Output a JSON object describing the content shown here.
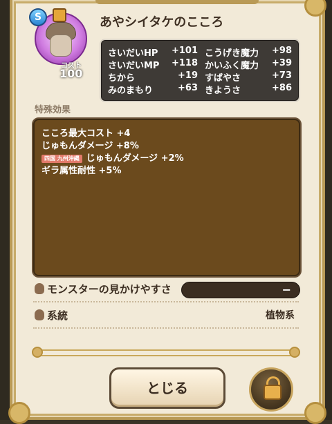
{
  "header": {
    "rarity": "S",
    "cost_label": "コスト",
    "cost_value": "100",
    "title": "あやシイタケのこころ"
  },
  "stats": [
    {
      "label": "さいだいHP",
      "value": "+101",
      "label2": "こうげき魔力",
      "value2": "+98"
    },
    {
      "label": "さいだいMP",
      "value": "+118",
      "label2": "かいふく魔力",
      "value2": "+39"
    },
    {
      "label": "ちから",
      "value": "+19",
      "label2": "すばやさ",
      "value2": "+73"
    },
    {
      "label": "みのまもり",
      "value": "+63",
      "label2": "きようさ",
      "value2": "+86"
    }
  ],
  "special": {
    "label": "特殊効果",
    "lines": [
      "こころ最大コスト +4",
      "じゅもんダメージ +8%",
      "じゅもんダメージ +2%",
      "ギラ属性耐性 +5%"
    ],
    "tag": "四国 九州沖縄"
  },
  "rows": {
    "appear_label": "モンスターの見かけやすさ",
    "appear_value": "−",
    "lineage_label": "系統",
    "lineage_value": "植物系"
  },
  "buttons": {
    "close": "とじる"
  },
  "colors": {
    "accent": "#c7a45e",
    "panel": "#f2ead8",
    "effects_bg": "#6b4a1d"
  }
}
